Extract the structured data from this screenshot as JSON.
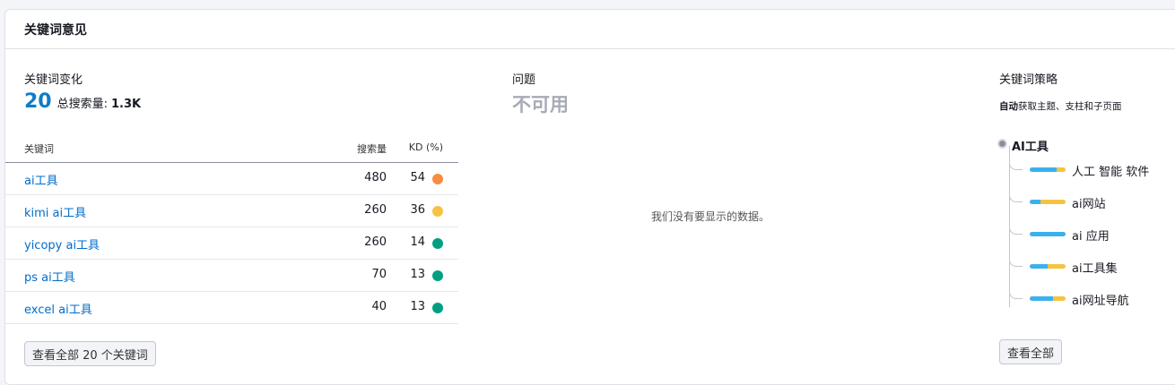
{
  "card": {
    "title": "关键词意见"
  },
  "left": {
    "section_title": "关键词变化",
    "count": "20",
    "summary_label": "总搜索量:",
    "summary_value": "1.3K",
    "columns": {
      "keyword": "关键词",
      "volume": "搜索量",
      "kd": "KD (%)"
    },
    "rows": [
      {
        "keyword": "ai工具",
        "volume": "480",
        "kd": "54",
        "kd_color": "#f88c43"
      },
      {
        "keyword": "kimi ai工具",
        "volume": "260",
        "kd": "36",
        "kd_color": "#f6c341"
      },
      {
        "keyword": "yicopy ai工具",
        "volume": "260",
        "kd": "14",
        "kd_color": "#009f81"
      },
      {
        "keyword": "ps ai工具",
        "volume": "70",
        "kd": "13",
        "kd_color": "#009f81"
      },
      {
        "keyword": "excel ai工具",
        "volume": "40",
        "kd": "13",
        "kd_color": "#009f81"
      }
    ],
    "view_all_label": "查看全部 20 个关键词"
  },
  "middle": {
    "section_title": "问题",
    "status": "不可用",
    "empty_message": "我们没有要显示的数据。"
  },
  "right": {
    "section_title": "关键词策略",
    "desc_bold": "自动",
    "desc_rest": "获取主题、支柱和子页面",
    "root": "AI工具",
    "branches": [
      {
        "label": "人工 智能 软件",
        "blue_share": 0.75
      },
      {
        "label": "ai网站",
        "blue_share": 0.3
      },
      {
        "label": "ai 应用",
        "blue_share": 1.0
      },
      {
        "label": "ai工具集",
        "blue_share": 0.5
      },
      {
        "label": "ai网址导航",
        "blue_share": 0.65
      }
    ],
    "view_all_label": "查看全部"
  }
}
